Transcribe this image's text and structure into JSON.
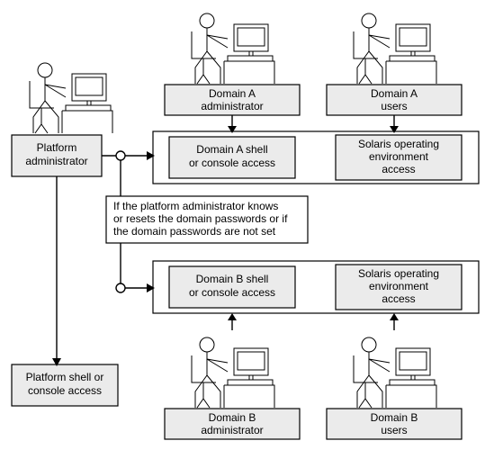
{
  "diagram": {
    "platform_admin": {
      "label": "Platform\nadministrator"
    },
    "platform_shell": {
      "label": "Platform shell or\nconsole access"
    },
    "condition": {
      "text": "If the platform administrator knows\nor resets the domain passwords or if\nthe domain passwords are not set"
    },
    "domain_a": {
      "admin_label": "Domain A\nadministrator",
      "users_label": "Domain A\nusers",
      "shell_label": "Domain A shell\nor console access",
      "os_label": "Solaris operating\nenvironment\naccess"
    },
    "domain_b": {
      "admin_label": "Domain B\nadministrator",
      "users_label": "Domain B\nusers",
      "shell_label": "Domain B shell\nor console access",
      "os_label": "Solaris operating\nenvironment\naccess"
    }
  }
}
